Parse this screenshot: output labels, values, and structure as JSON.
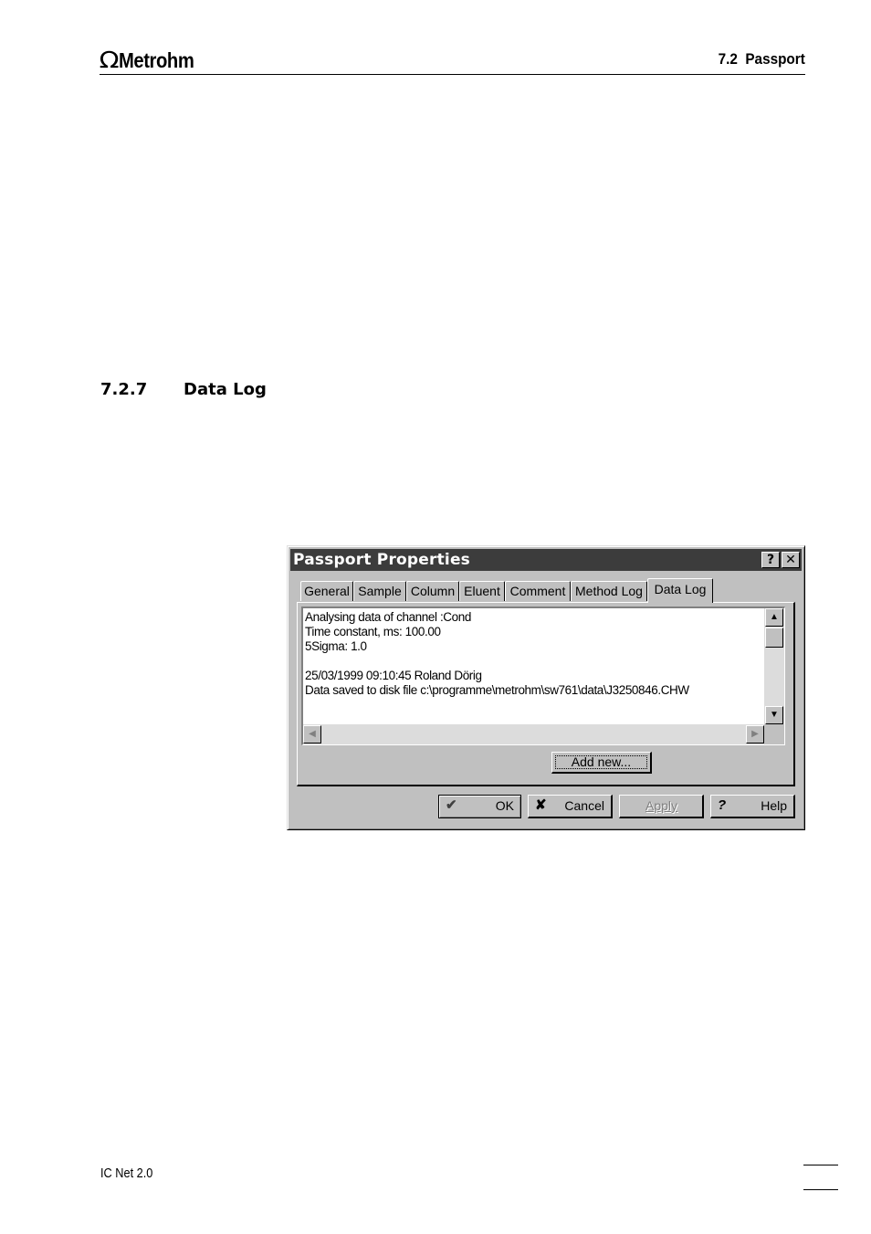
{
  "header": {
    "logo_symbol": "Ω",
    "logo_text": "Metrohm",
    "section": "7.2  Passport"
  },
  "section_heading": {
    "number": "7.2.7",
    "title": "Data Log"
  },
  "dialog": {
    "title": "Passport Properties",
    "help_glyph": "?",
    "close_glyph": "✕",
    "tabs": [
      {
        "label": "General"
      },
      {
        "label": "Sample"
      },
      {
        "label": "Column"
      },
      {
        "label": "Eluent"
      },
      {
        "label": "Comment"
      },
      {
        "label": "Method Log"
      },
      {
        "label": "Data Log",
        "active": true
      }
    ],
    "log_lines": [
      "Analysing data of channel :Cond",
      "Time constant, ms: 100.00",
      "5Sigma: 1.0",
      "",
      "25/03/1999 09:10:45 Roland Dörig",
      "Data saved to disk file c:\\programme\\metrohm\\sw761\\data\\J3250846.CHW"
    ],
    "add_new_label": "Add new...",
    "buttons": {
      "ok": "OK",
      "cancel": "Cancel",
      "apply": "Apply",
      "help": "Help"
    }
  },
  "footer": {
    "product": "IC Net 2.0"
  }
}
